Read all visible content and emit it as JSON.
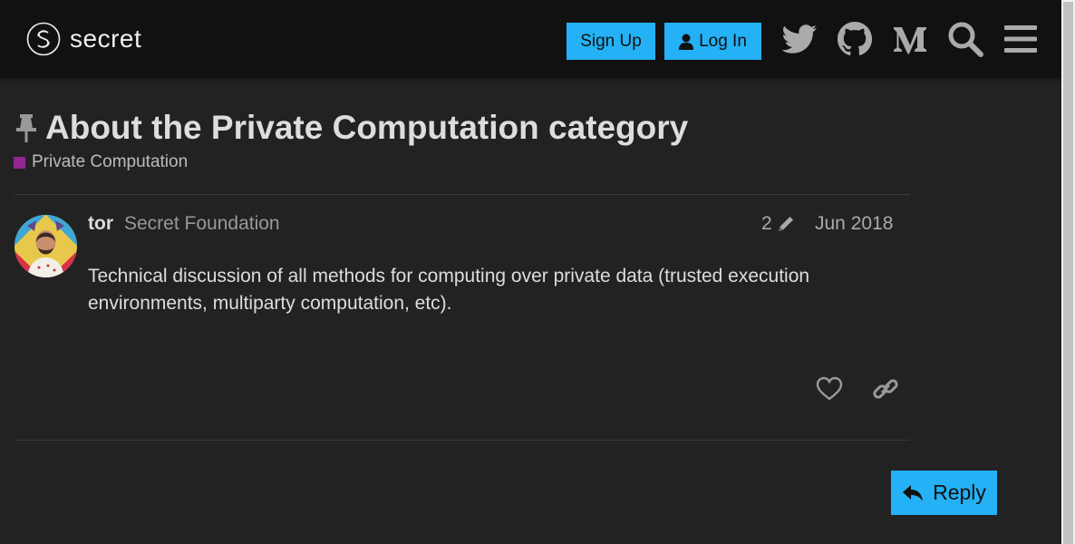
{
  "header": {
    "logo_text": "secret",
    "signup_label": "Sign Up",
    "login_label": "Log In",
    "icons": [
      "twitter-icon",
      "github-icon",
      "medium-icon",
      "search-icon",
      "hamburger-menu-icon"
    ]
  },
  "topic": {
    "title": "About the Private Computation category",
    "category": "Private Computation",
    "category_color": "#92278f"
  },
  "post": {
    "username": "tor",
    "user_title": "Secret Foundation",
    "edit_count": "2",
    "date": "Jun 2018",
    "body": "Technical discussion of all methods for computing over private data (trusted execution environments, multiparty computation, etc)."
  },
  "actions": {
    "reply_label": "Reply"
  },
  "colors": {
    "accent": "#24b1f5",
    "header_bg": "#111111",
    "page_bg": "#222222"
  }
}
